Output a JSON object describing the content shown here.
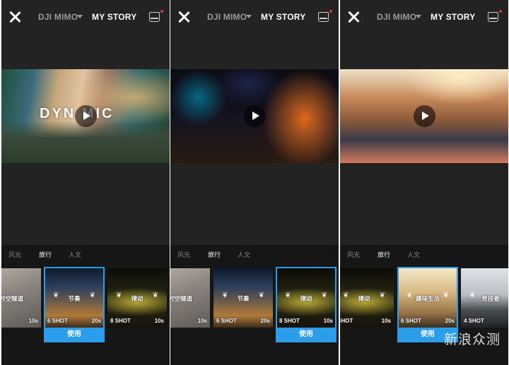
{
  "header": {
    "tab_mimo": "DJI MIMO",
    "tab_story": "MY STORY"
  },
  "categories": [
    "风光",
    "旅行",
    "人文"
  ],
  "use_label": "使用",
  "dynamic_text": "DYN MIC",
  "watermark": "新浪众测",
  "panels": [
    {
      "cards": [
        {
          "name": "时空隧道",
          "shot": "",
          "duration": "10s"
        },
        {
          "name": "节奏",
          "shot": "6 SHOT",
          "duration": "20s"
        },
        {
          "name": "律动",
          "shot": "8 SHOT",
          "duration": "10s"
        }
      ]
    },
    {
      "cards": [
        {
          "name": "时空隧道",
          "shot": "",
          "duration": "10s"
        },
        {
          "name": "节奏",
          "shot": "6 SHOT",
          "duration": "20s"
        },
        {
          "name": "律动",
          "shot": "8 SHOT",
          "duration": "10s"
        }
      ]
    },
    {
      "cards": [
        {
          "name": "律动",
          "shot": "SHOT",
          "duration": "10s"
        },
        {
          "name": "趣味生活",
          "shot": "6 SHOT",
          "duration": "20s"
        },
        {
          "name": "竞技者",
          "shot": "4 SHOT",
          "duration": ""
        }
      ]
    }
  ],
  "colors": {
    "accent": "#2b9dea",
    "background": "#232323",
    "notify_dot": "#e0323c"
  }
}
